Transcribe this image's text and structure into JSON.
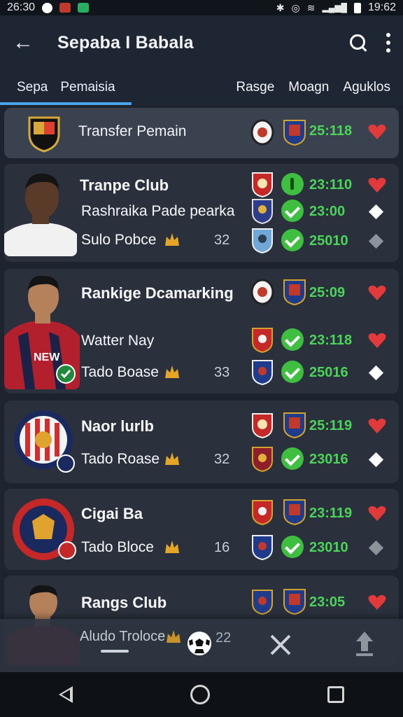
{
  "status_bar": {
    "time_left": "26:30",
    "time_right": "19:62"
  },
  "app_bar": {
    "title": "Sepaba I Babala"
  },
  "tabs": {
    "left": [
      "Sepa",
      "Pemaisia"
    ],
    "right": [
      "Rasge",
      "Moagn",
      "Aguklos"
    ]
  },
  "transfer": {
    "label": "Transfer Pemain",
    "time": "25:118"
  },
  "cards": [
    {
      "rows": [
        {
          "label": "Tranpe Club",
          "time": "23:110",
          "end": "heart"
        },
        {
          "label": "Rashraika Pade pearka",
          "time": "23:00",
          "end": "diamond"
        },
        {
          "label": "Sulo Pobce",
          "num": "32",
          "time": "25010",
          "end": "diamond-grey"
        }
      ]
    },
    {
      "rows": [
        {
          "label": "Rankige Dcamarking",
          "time": "25:09",
          "end": "heart"
        },
        {
          "label": "Watter Nay",
          "time": "23:118",
          "end": "heart"
        },
        {
          "label": "Tado Boase",
          "num": "33",
          "time": "25016",
          "end": "diamond"
        }
      ],
      "shirt_text": "NEW"
    },
    {
      "rows": [
        {
          "label": "Naor lurlb",
          "time": "25:119",
          "end": "heart"
        },
        {
          "label": "Tado Roase",
          "num": "32",
          "time": "23016",
          "end": "diamond"
        }
      ]
    },
    {
      "rows": [
        {
          "label": "Cigai Ba",
          "time": "23:119",
          "end": "heart"
        },
        {
          "label": "Tado Bloce",
          "num": "16",
          "time": "23010",
          "end": "diamond-grey"
        }
      ]
    },
    {
      "rows": [
        {
          "label": "Rangs Club",
          "time": "23:05",
          "end": "heart"
        }
      ]
    }
  ],
  "bottom_nav": {
    "label": "Aludo Troloce",
    "num": "22"
  },
  "colors": {
    "accent": "#4aa3e8",
    "time_green": "#4bd35a",
    "heart_red": "#e23a3a",
    "card_bg": "#2a313d"
  }
}
